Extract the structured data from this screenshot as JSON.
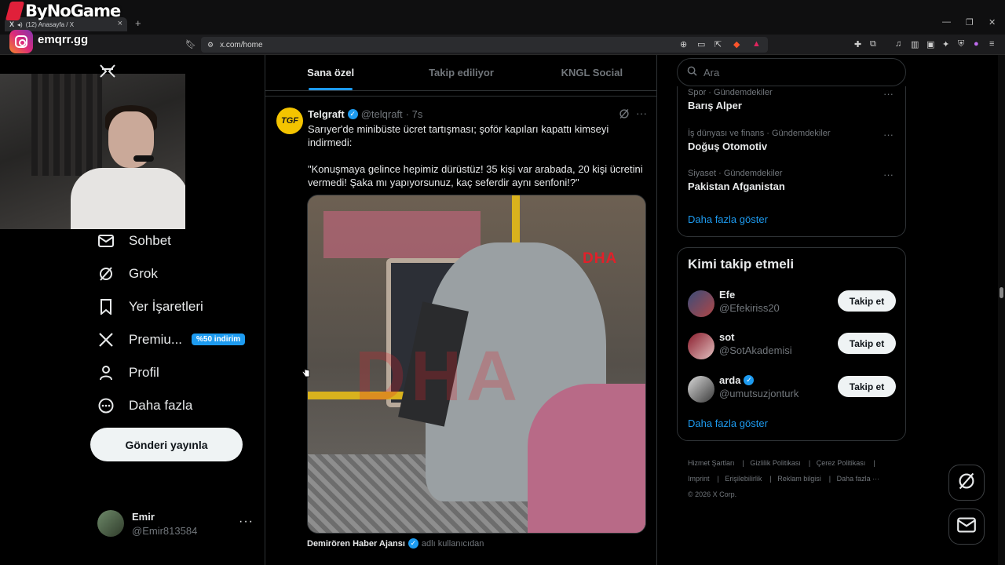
{
  "overlay": {
    "brand": "ByNoGame",
    "handle": "emqrr.gg"
  },
  "browser": {
    "tab_title": "(12) Anasayfa / X",
    "url": "x.com/home"
  },
  "sidebar": {
    "items": [
      {
        "label": "Sohbet",
        "icon": "mail-icon"
      },
      {
        "label": "Grok",
        "icon": "grok-icon"
      },
      {
        "label": "Yer İşaretleri",
        "icon": "bookmark-icon"
      },
      {
        "label": "Premiu...",
        "icon": "x-logo-icon"
      },
      {
        "label": "Profil",
        "icon": "person-icon"
      },
      {
        "label": "Daha fazla",
        "icon": "more-circle-icon"
      }
    ],
    "premium_badge": "%50 indirim",
    "post_button": "Gönderi yayınla",
    "account": {
      "name": "Emir",
      "handle": "@Emir813584",
      "more": "···"
    }
  },
  "main": {
    "tabs": [
      "Sana özel",
      "Takip ediliyor",
      "KNGL Social"
    ],
    "tweet": {
      "avatar_text": "TGF",
      "name": "Telgraft",
      "handle": "@telqraft",
      "time": "· 7s",
      "text": "Sarıyer'de minibüste ücret tartışması; şoför kapıları kapattı kimseyi indirmedi:\n\n\"Konuşmaya gelince hepimiz dürüstüz! 35 kişi var arabada, 20 kişi ücretini vermedi! Şaka mı yapıyorsunuz, kaç seferdir aynı senfoni!?\"",
      "media_watermark": "DHA",
      "source_name": "Demirören Haber Ajansı",
      "source_suffix": "adlı kullanıcıdan"
    }
  },
  "right": {
    "search_placeholder": "Ara",
    "trends": [
      {
        "category": "Spor · Gündemdekiler",
        "title": "Barış Alper"
      },
      {
        "category": "İş dünyası ve finans · Gündemdekiler",
        "title": "Doğuş Otomotiv"
      },
      {
        "category": "Siyaset · Gündemdekiler",
        "title": "Pakistan Afganistan"
      }
    ],
    "trends_show_more": "Daha fazla göster",
    "who_title": "Kimi takip etmeli",
    "who": [
      {
        "name": "Efe",
        "handle": "@Efekiriss20",
        "verified": false,
        "button": "Takip et"
      },
      {
        "name": "sot",
        "handle": "@SotAkademisi",
        "verified": false,
        "button": "Takip et"
      },
      {
        "name": "arda",
        "handle": "@umutsuzjonturk",
        "verified": true,
        "button": "Takip et"
      }
    ],
    "who_show_more": "Daha fazla göster",
    "footer": [
      "Hizmet Şartları",
      "Gizlilik Politikası",
      "Çerez Politikası",
      "Imprint",
      "Erişilebilirlik",
      "Reklam bilgisi",
      "Daha fazla ···",
      "© 2026 X Corp."
    ]
  },
  "colors": {
    "accent": "#1d9bf0",
    "background": "#000000",
    "border": "#2f3336",
    "muted": "#71767b"
  }
}
